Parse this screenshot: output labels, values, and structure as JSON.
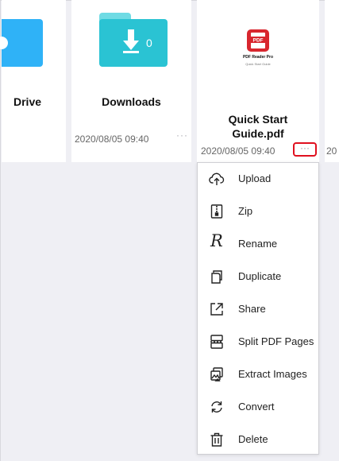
{
  "files": {
    "drive": {
      "label": "Drive"
    },
    "downloads": {
      "label": "Downloads",
      "count": "0",
      "date": "2020/08/05 09:40",
      "more": "···"
    },
    "guide": {
      "thumb_app": "PDF Reader Pro",
      "thumb_subtitle": "Quick Start Guide",
      "thumb_badge": "PDF",
      "title_line1": "Quick Start",
      "title_line2": "Guide.pdf",
      "date": "2020/08/05 09:40",
      "more": "···"
    },
    "partial": {
      "date": "20"
    }
  },
  "menu": {
    "items": [
      {
        "label": "Upload",
        "icon": "upload-cloud-icon"
      },
      {
        "label": "Zip",
        "icon": "zip-icon"
      },
      {
        "label": "Rename",
        "icon": "rename-icon",
        "glyph": "R"
      },
      {
        "label": "Duplicate",
        "icon": "duplicate-icon"
      },
      {
        "label": "Share",
        "icon": "share-icon"
      },
      {
        "label": "Split PDF Pages",
        "icon": "split-pages-icon"
      },
      {
        "label": "Extract Images",
        "icon": "extract-images-icon"
      },
      {
        "label": "Convert",
        "icon": "convert-icon"
      },
      {
        "label": "Delete",
        "icon": "trash-icon"
      }
    ]
  },
  "colors": {
    "highlight": "#e0101f",
    "folder": "#2ac3d3",
    "drive": "#2fb2f7",
    "background": "#efeff4"
  }
}
